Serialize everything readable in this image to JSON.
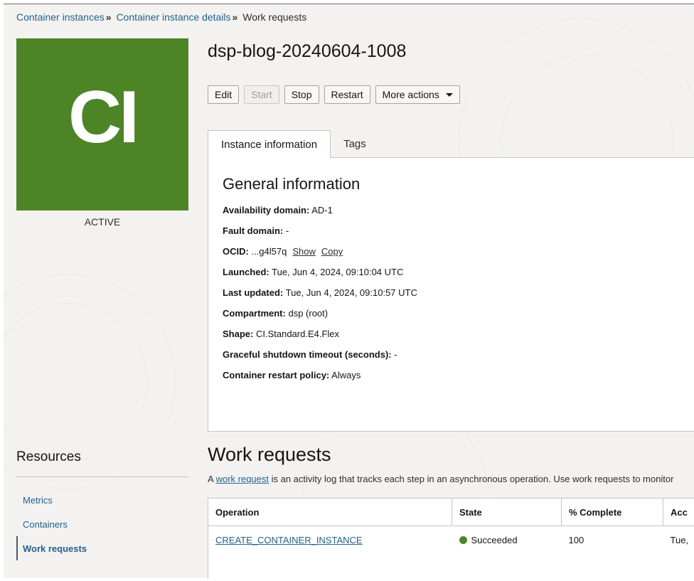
{
  "breadcrumb": {
    "items": [
      "Container instances",
      "Container instance details"
    ],
    "separator": "»",
    "current": "Work requests"
  },
  "tile": {
    "initials": "CI",
    "color": "#4d8526",
    "status": "ACTIVE"
  },
  "instance": {
    "title": "dsp-blog-20240604-1008"
  },
  "actions": {
    "edit": "Edit",
    "start": "Start",
    "stop": "Stop",
    "restart": "Restart",
    "more": "More actions",
    "more_icon": "caret-down-icon"
  },
  "tabs": [
    "Instance information",
    "Tags"
  ],
  "general": {
    "title": "General information",
    "rows": [
      {
        "label": "Availability domain:",
        "value": "AD-1"
      },
      {
        "label": "Fault domain:",
        "value": "-"
      },
      {
        "label": "OCID:",
        "value": "...g4l57q",
        "show": "Show",
        "copy": "Copy"
      },
      {
        "label": "Launched:",
        "value": "Tue, Jun 4, 2024, 09:10:04 UTC"
      },
      {
        "label": "Last updated:",
        "value": "Tue, Jun 4, 2024, 09:10:57 UTC"
      },
      {
        "label": "Compartment:",
        "value": "dsp (root)"
      },
      {
        "label": "Shape:",
        "value": "CI.Standard.E4.Flex"
      },
      {
        "label": "Graceful shutdown timeout (seconds):",
        "value": "-"
      },
      {
        "label": "Container restart policy:",
        "value": "Always"
      }
    ]
  },
  "resources": {
    "title": "Resources",
    "items": [
      "Metrics",
      "Containers",
      "Work requests"
    ],
    "active": "Work requests"
  },
  "work_requests": {
    "title": "Work requests",
    "desc_prefix": "A ",
    "desc_link": "work request",
    "desc_suffix": " is an activity log that tracks each step in an asynchronous operation. Use work requests to monitor",
    "columns": [
      "Operation",
      "State",
      "% Complete",
      "Acc"
    ],
    "rows": [
      {
        "operation": "CREATE_CONTAINER_INSTANCE",
        "state": "Succeeded",
        "state_color": "#4d8526",
        "percent": "100",
        "accepted": "Tue,"
      }
    ]
  }
}
